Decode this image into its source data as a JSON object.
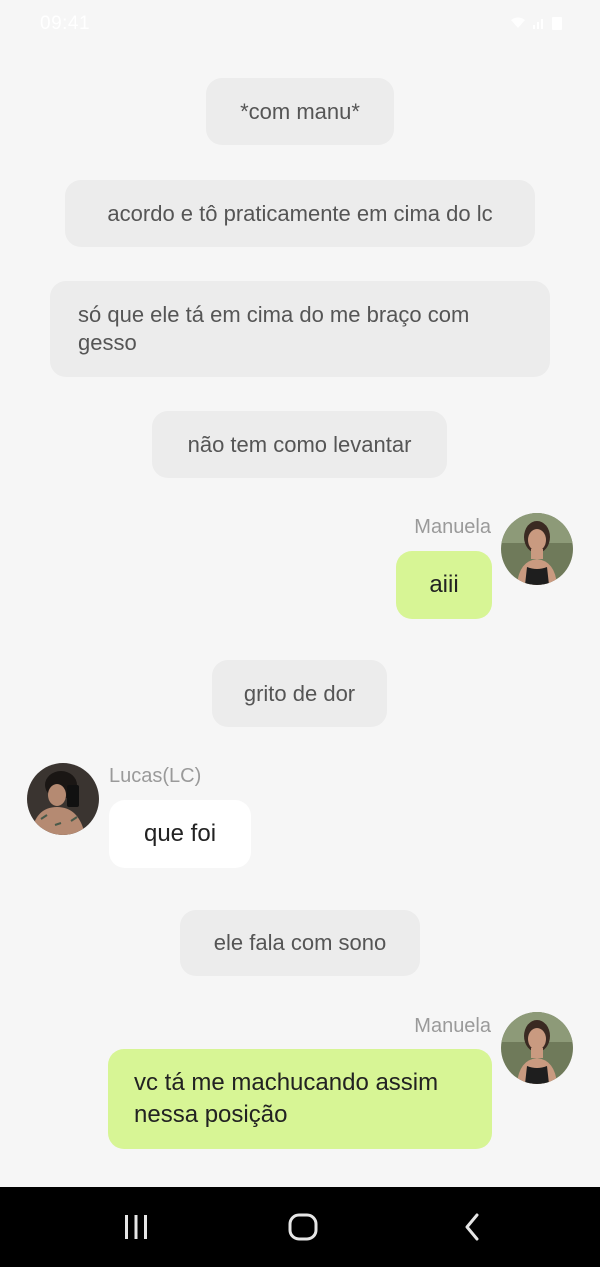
{
  "status_bar": {
    "time": "09:41",
    "icons": [
      "wifi-icon",
      "signal-icon",
      "battery-icon"
    ]
  },
  "messages": [
    {
      "kind": "narration",
      "text": "*com manu*"
    },
    {
      "kind": "narration",
      "text": "acordo e tô praticamente em cima do lc"
    },
    {
      "kind": "narration",
      "text": "só que ele tá em cima do me braço com gesso"
    },
    {
      "kind": "narration",
      "text": "não tem como levantar"
    },
    {
      "kind": "sent",
      "sender": "Manuela",
      "text": "aiii"
    },
    {
      "kind": "narration",
      "text": "grito de dor"
    },
    {
      "kind": "received",
      "sender": "Lucas(LC)",
      "text": "que foi"
    },
    {
      "kind": "narration",
      "text": "ele fala com sono"
    },
    {
      "kind": "sent",
      "sender": "Manuela",
      "text": "vc tá me machucando assim nessa posição"
    }
  ],
  "colors": {
    "background": "#f6f6f6",
    "narration_pill": "#ececec",
    "sent_bubble": "#d7f595",
    "received_bubble": "#ffffff",
    "nav_bar": "#000000"
  },
  "nav_bar": {
    "buttons": [
      "recent-apps-icon",
      "home-icon",
      "back-icon"
    ]
  }
}
